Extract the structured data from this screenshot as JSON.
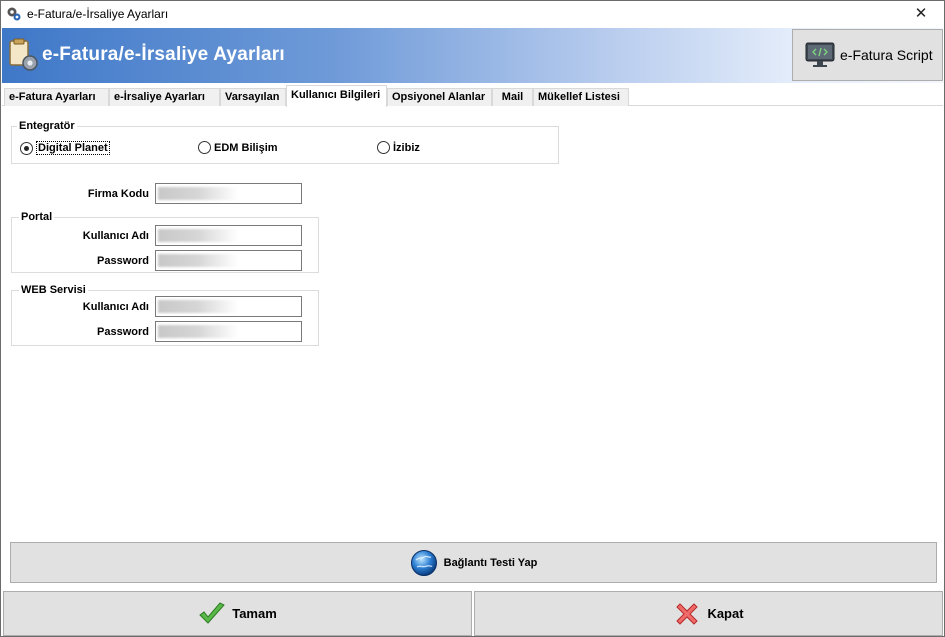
{
  "window": {
    "title": "e-Fatura/e-İrsaliye Ayarları",
    "close_glyph": "✕"
  },
  "banner": {
    "title": "e-Fatura/e-İrsaliye Ayarları",
    "script_button": "e-Fatura Script"
  },
  "tabs": [
    {
      "label": "e-Fatura Ayarları",
      "active": false
    },
    {
      "label": "e-İrsaliye Ayarları",
      "active": false
    },
    {
      "label": "Varsayılan",
      "active": false
    },
    {
      "label": "Kullanıcı Bilgileri",
      "active": true
    },
    {
      "label": "Opsiyonel Alanlar",
      "active": false
    },
    {
      "label": "Mail",
      "active": false
    },
    {
      "label": "Mükellef Listesi",
      "active": false
    }
  ],
  "integrator": {
    "legend": "Entegratör",
    "options": [
      {
        "label": "Digital Planet",
        "selected": true
      },
      {
        "label": "EDM Bilişim",
        "selected": false
      },
      {
        "label": "İzibiz",
        "selected": false
      }
    ]
  },
  "firm_code": {
    "label": "Firma Kodu",
    "value": ""
  },
  "portal": {
    "legend": "Portal",
    "username_label": "Kullanıcı Adı",
    "password_label": "Password"
  },
  "web_service": {
    "legend": "WEB Servisi",
    "username_label": "Kullanıcı Adı",
    "password_label": "Password"
  },
  "buttons": {
    "test_connection": "Bağlantı Testi Yap",
    "ok": "Tamam",
    "close": "Kapat"
  },
  "colors": {
    "banner_start": "#3f78c8",
    "banner_end": "#f2f6fd",
    "button_face": "#e1e1e1",
    "ok_icon": "#4caf50",
    "close_icon": "#e53935"
  },
  "icons": {
    "app": "gear-document-icon",
    "banner": "document-gear-icon",
    "script": "code-monitor-icon",
    "test": "globe-icon",
    "ok": "checkmark-icon",
    "close": "red-x-icon"
  }
}
